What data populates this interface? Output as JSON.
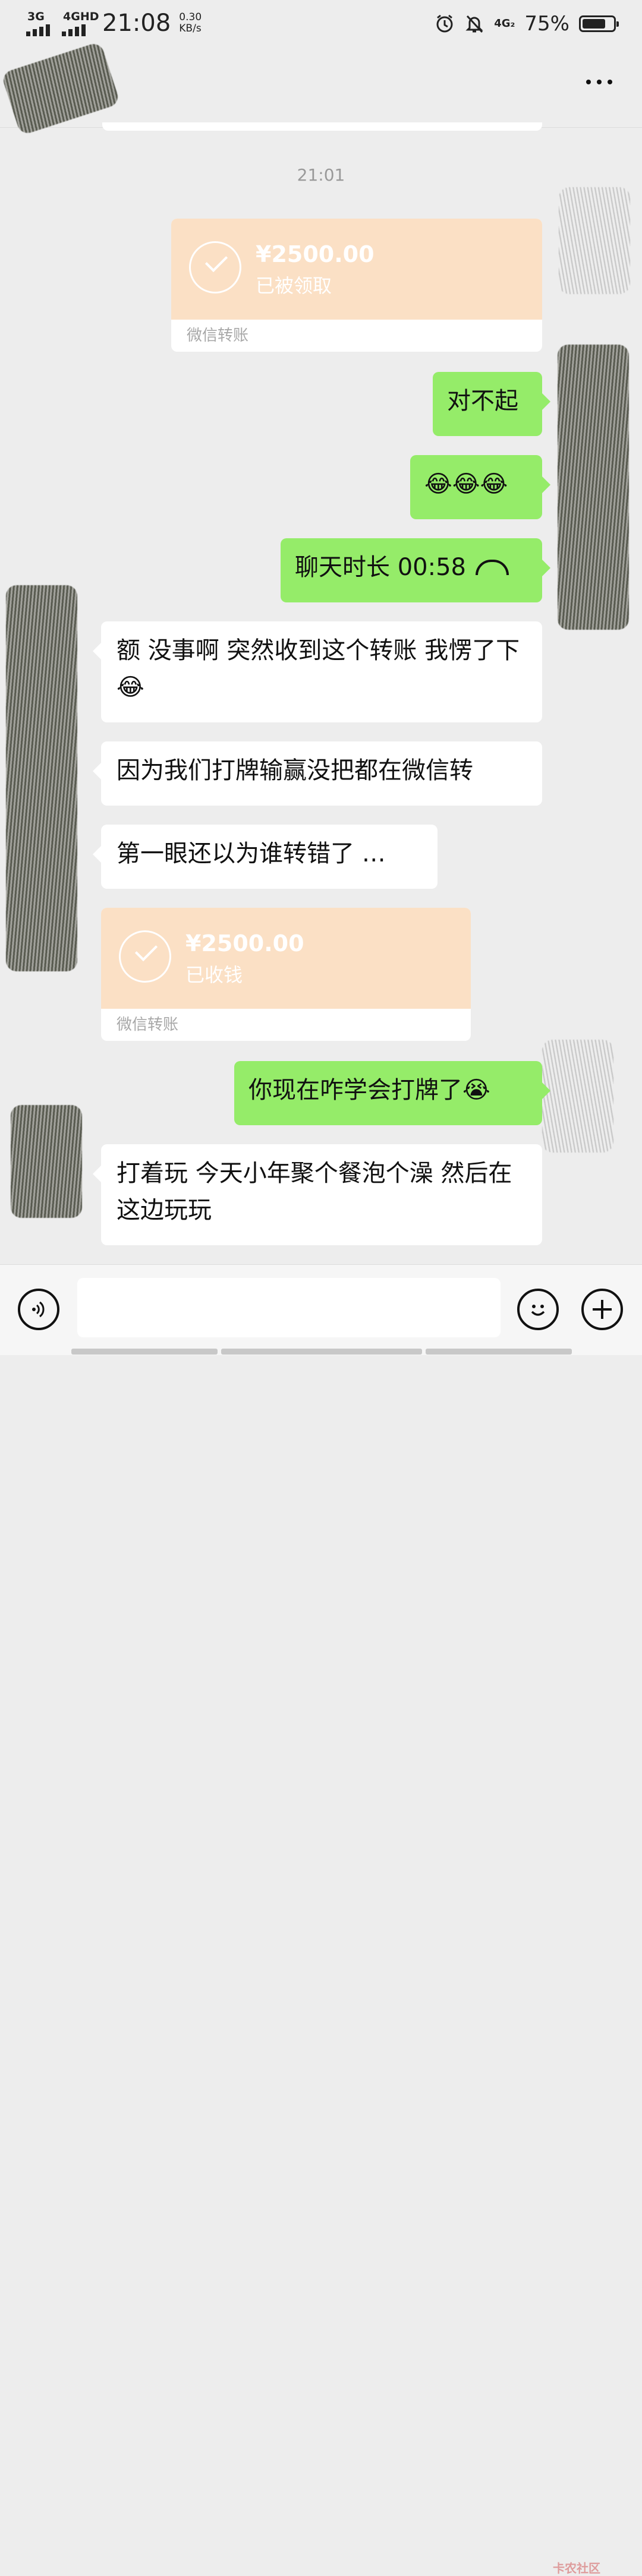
{
  "status_bar": {
    "net1": "3G",
    "net2": "4GHD",
    "time": "21:08",
    "speed_value": "0.30",
    "speed_unit": "KB/s",
    "net3": "4G₂",
    "battery_text": "75%",
    "battery_level": 0.75,
    "icons": [
      "alarm-icon",
      "mute-icon"
    ]
  },
  "header": {
    "more_icon": "more-icon"
  },
  "messages": {
    "timestamp": "21:01",
    "transfer_sent": {
      "amount": "¥2500.00",
      "status": "已被领取",
      "footer": "微信转账"
    },
    "m1": "对不起",
    "m2": "😂😂😂",
    "m3": "聊天时长 00:58",
    "m4": "额 没事啊 突然收到这个转账 我愣了下 😂",
    "m5": "因为我们打牌输赢没把都在微信转",
    "m6": "第一眼还以为谁转错了 …",
    "transfer_received": {
      "amount": "¥2500.00",
      "status": "已收钱",
      "footer": "微信转账"
    },
    "m7": "你现在咋学会打牌了😭",
    "m8": "打着玩 今天小年聚个餐泡个澡 然后在这边玩玩"
  },
  "input_bar": {
    "input_value": "",
    "watermark": "卡农社区"
  },
  "colors": {
    "background": "#ededed",
    "my_bubble": "#95ec69",
    "other_bubble": "#ffffff",
    "transfer": "#fbe0c5"
  }
}
